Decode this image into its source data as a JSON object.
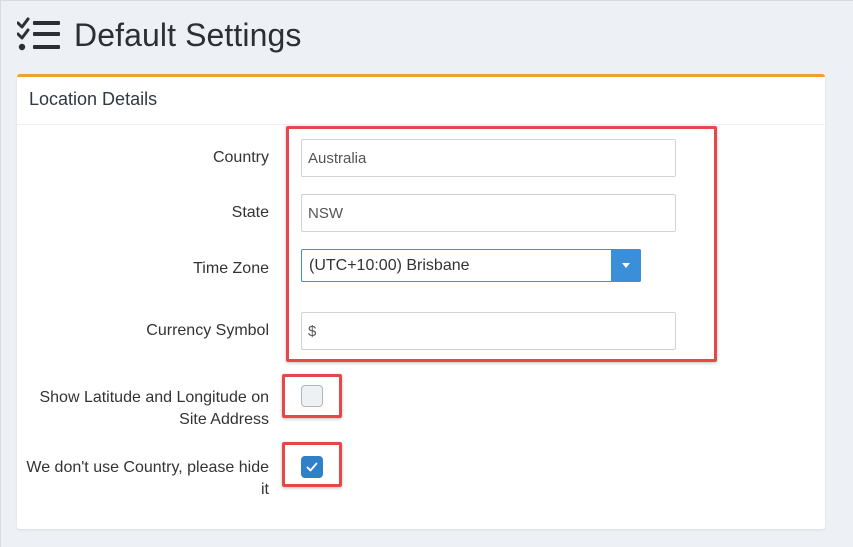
{
  "page": {
    "title": "Default Settings",
    "title_icon": "checklist-icon"
  },
  "panel": {
    "title": "Location Details",
    "accent_color": "#f0a030"
  },
  "fields": {
    "country": {
      "label": "Country",
      "value": "Australia"
    },
    "state": {
      "label": "State",
      "value": "NSW"
    },
    "time_zone": {
      "label": "Time Zone",
      "value": "(UTC+10:00) Brisbane"
    },
    "currency_symbol": {
      "label": "Currency Symbol",
      "value": "$"
    },
    "show_lat_long": {
      "label_line1": "Show Latitude and Longitude on",
      "label_line2": "Site Address",
      "checked": false
    },
    "hide_country": {
      "label_line1": "We don't use Country, please hide",
      "label_line2": "it",
      "checked": true
    }
  },
  "colors": {
    "highlight": "#e5474b",
    "primary": "#3a8fd8",
    "checkbox_checked": "#2f80c9"
  }
}
